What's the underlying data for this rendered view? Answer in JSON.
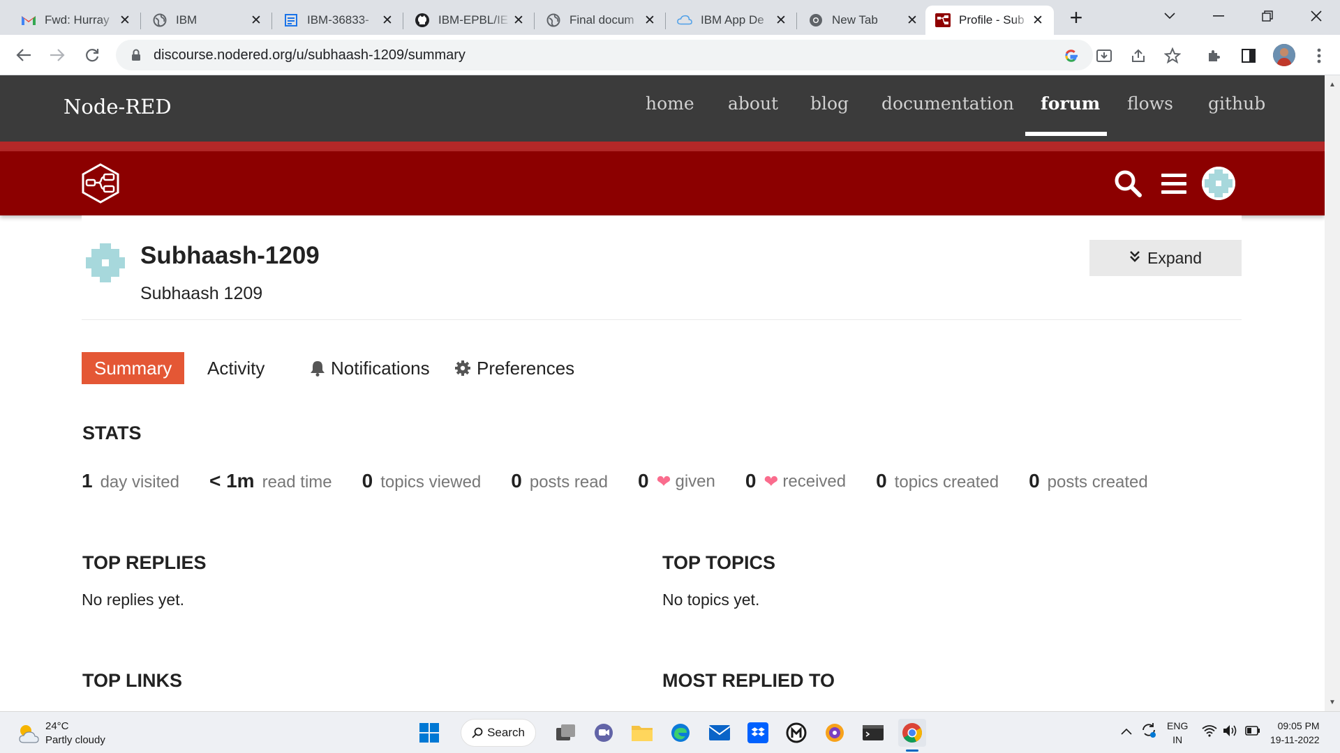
{
  "browser": {
    "tabs": [
      {
        "title": "Fwd: Hurray",
        "icon": "gmail-icon"
      },
      {
        "title": "IBM",
        "icon": "globe-icon"
      },
      {
        "title": "IBM-36833-",
        "icon": "document-icon"
      },
      {
        "title": "IBM-EPBL/IE",
        "icon": "github-icon"
      },
      {
        "title": "Final docum",
        "icon": "globe-icon"
      },
      {
        "title": "IBM App De",
        "icon": "cloud-icon"
      },
      {
        "title": "New Tab",
        "icon": "chrome-icon"
      },
      {
        "title": "Profile - Sub",
        "icon": "node-red-icon"
      }
    ],
    "active_tab": 7,
    "url": "discourse.nodered.org/u/subhaash-1209/summary"
  },
  "site": {
    "logo": "Node-RED",
    "nav": [
      {
        "label": "home"
      },
      {
        "label": "about"
      },
      {
        "label": "blog"
      },
      {
        "label": "documentation"
      },
      {
        "label": "forum"
      },
      {
        "label": "flows"
      },
      {
        "label": "github"
      }
    ],
    "active_nav": "forum"
  },
  "profile": {
    "username": "Subhaash-1209",
    "full_name": "Subhaash 1209",
    "expand_label": "Expand",
    "nav": {
      "summary": "Summary",
      "activity": "Activity",
      "notifications": "Notifications",
      "preferences": "Preferences"
    }
  },
  "stats": {
    "title": "STATS",
    "items": [
      {
        "value": "1",
        "label": "day visited"
      },
      {
        "value": "< 1m",
        "label": "read time"
      },
      {
        "value": "0",
        "label": "topics viewed"
      },
      {
        "value": "0",
        "label": "posts read"
      },
      {
        "value": "0",
        "label": "given"
      },
      {
        "value": "0",
        "label": "received"
      },
      {
        "value": "0",
        "label": "topics created"
      },
      {
        "value": "0",
        "label": "posts created"
      }
    ]
  },
  "sections": {
    "top_replies": {
      "title": "TOP REPLIES",
      "empty": "No replies yet."
    },
    "top_topics": {
      "title": "TOP TOPICS",
      "empty": "No topics yet."
    },
    "top_links": {
      "title": "TOP LINKS"
    },
    "most_replied": {
      "title": "MOST REPLIED TO"
    }
  },
  "taskbar": {
    "weather_temp": "24°C",
    "weather_desc": "Partly cloudy",
    "search_label": "Search",
    "lang_line1": "ENG",
    "lang_line2": "IN",
    "time": "09:05 PM",
    "date": "19-11-2022"
  },
  "colors": {
    "site_header": "#3b3b3b",
    "forum_header": "#8c0000",
    "accent": "#e45735",
    "heart": "#fa6c8d"
  }
}
